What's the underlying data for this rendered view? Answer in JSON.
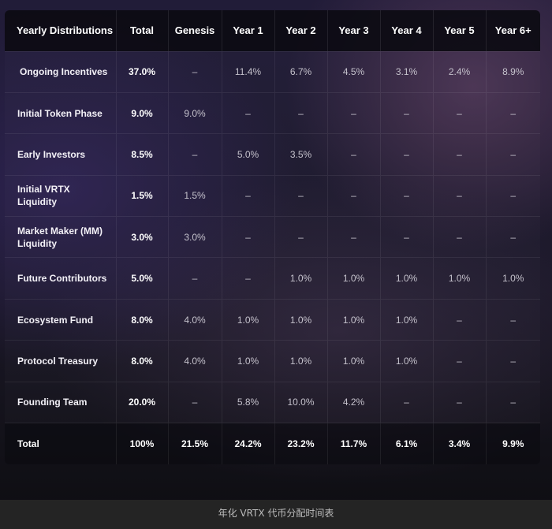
{
  "table": {
    "headers": [
      "Yearly Distributions",
      "Total",
      "Genesis",
      "Year 1",
      "Year 2",
      "Year 3",
      "Year 4",
      "Year 5",
      "Year 6+"
    ],
    "rows": [
      [
        "Ongoing Incentives",
        "37.0%",
        "–",
        "11.4%",
        "6.7%",
        "4.5%",
        "3.1%",
        "2.4%",
        "8.9%"
      ],
      [
        "Initial Token Phase",
        "9.0%",
        "9.0%",
        "–",
        "–",
        "–",
        "–",
        "–",
        "–"
      ],
      [
        "Early Investors",
        "8.5%",
        "–",
        "5.0%",
        "3.5%",
        "–",
        "–",
        "–",
        "–"
      ],
      [
        "Initial VRTX Liquidity",
        "1.5%",
        "1.5%",
        "–",
        "–",
        "–",
        "–",
        "–",
        "–"
      ],
      [
        "Market Maker (MM) Liquidity",
        "3.0%",
        "3.0%",
        "–",
        "–",
        "–",
        "–",
        "–",
        "–"
      ],
      [
        "Future Contributors",
        "5.0%",
        "–",
        "–",
        "1.0%",
        "1.0%",
        "1.0%",
        "1.0%",
        "1.0%"
      ],
      [
        "Ecosystem Fund",
        "8.0%",
        "4.0%",
        "1.0%",
        "1.0%",
        "1.0%",
        "1.0%",
        "–",
        "–"
      ],
      [
        "Protocol Treasury",
        "8.0%",
        "4.0%",
        "1.0%",
        "1.0%",
        "1.0%",
        "1.0%",
        "–",
        "–"
      ],
      [
        "Founding Team",
        "20.0%",
        "–",
        "5.8%",
        "10.0%",
        "4.2%",
        "–",
        "–",
        "–"
      ],
      [
        "Total",
        "100%",
        "21.5%",
        "24.2%",
        "23.2%",
        "11.7%",
        "6.1%",
        "3.4%",
        "9.9%"
      ]
    ]
  },
  "caption": "年化 VRTX 代币分配时间表"
}
